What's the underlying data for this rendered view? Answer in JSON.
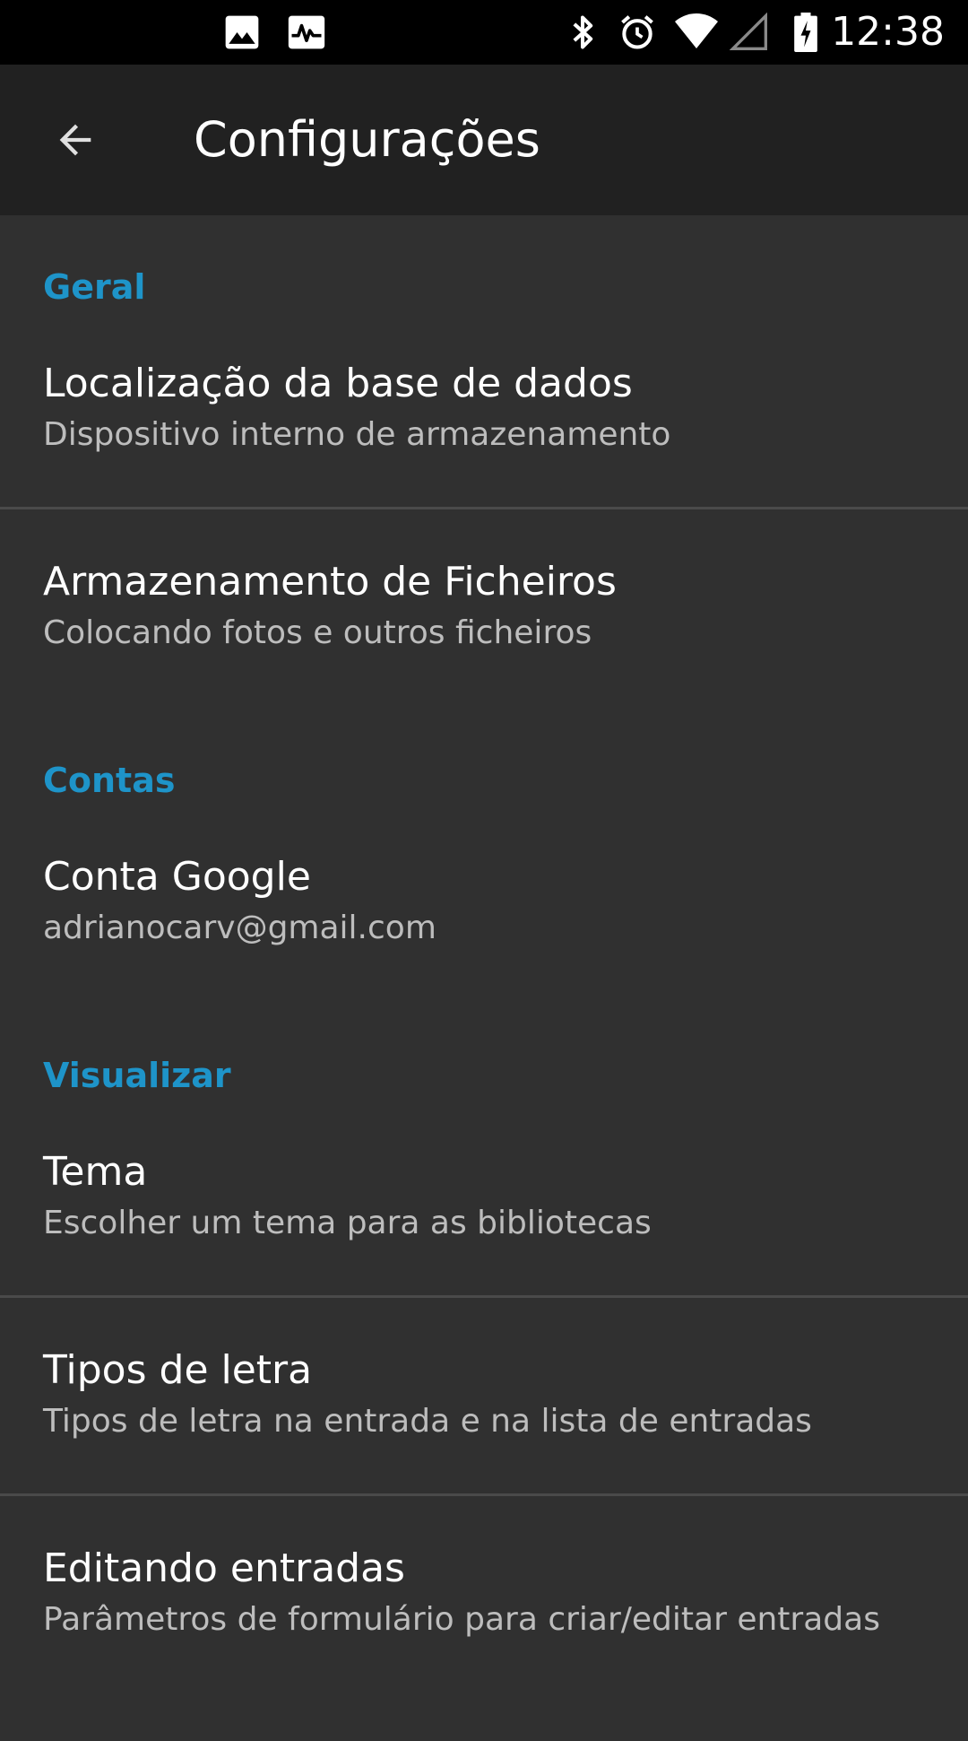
{
  "status_bar": {
    "time": "12:38",
    "icons": [
      "image-icon",
      "activity-icon",
      "bluetooth-icon",
      "alarm-icon",
      "wifi-icon",
      "signal-icon",
      "battery-charging-icon"
    ]
  },
  "toolbar": {
    "title": "Configurações",
    "back_icon": "arrow-back-icon"
  },
  "sections": {
    "general": {
      "header": "Geral",
      "items": [
        {
          "title": "Localização da base de dados",
          "summary": "Dispositivo interno de armazenamento"
        },
        {
          "title": "Armazenamento de Ficheiros",
          "summary": "Colocando fotos e outros ficheiros"
        }
      ]
    },
    "accounts": {
      "header": "Contas",
      "items": [
        {
          "title": "Conta Google",
          "summary": "adrianocarv@gmail.com"
        }
      ]
    },
    "display": {
      "header": "Visualizar",
      "items": [
        {
          "title": "Tema",
          "summary": "Escolher um tema para as bibliotecas"
        },
        {
          "title": "Tipos de letra",
          "summary": "Tipos de letra na entrada e na lista de entradas"
        },
        {
          "title": "Editando entradas",
          "summary": "Parâmetros de formulário para criar/editar entradas"
        }
      ]
    }
  },
  "colors": {
    "accent": "#1e94c9",
    "background": "#303030",
    "toolbar": "#212121",
    "status_bar": "#000000",
    "divider": "#4a4a4a"
  }
}
